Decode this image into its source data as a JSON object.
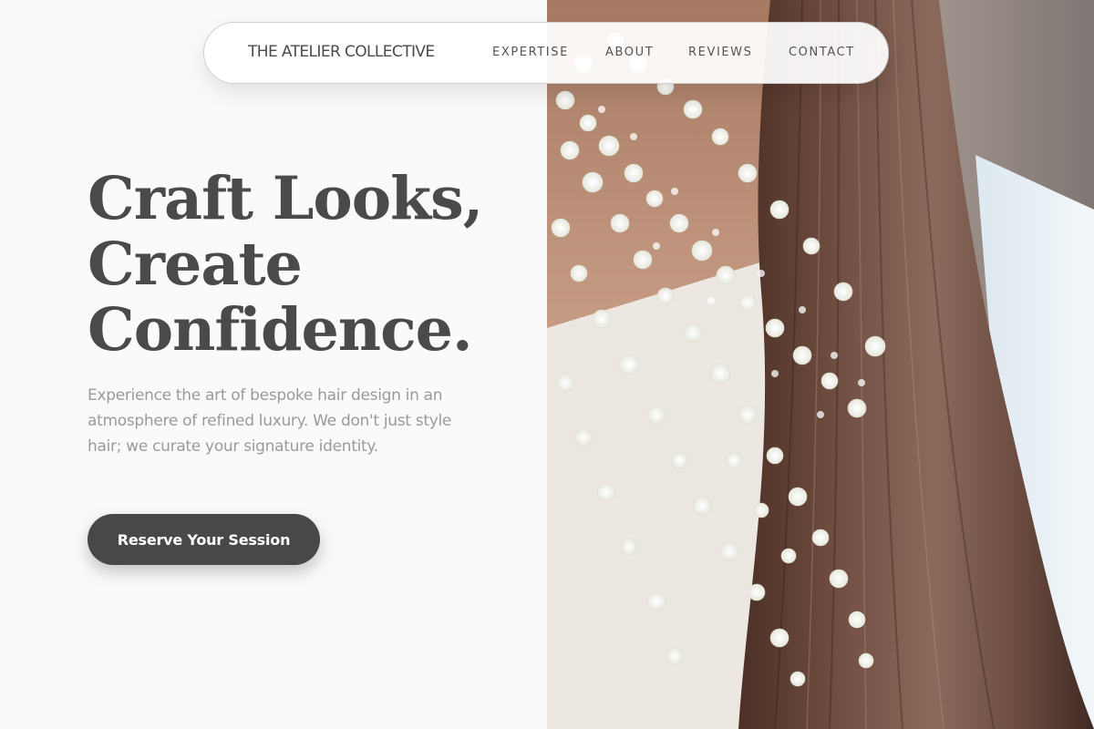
{
  "navbar": {
    "brand": "THE ATELIER COLLECTIVE",
    "links": [
      {
        "label": "EXPERTISE"
      },
      {
        "label": "ABOUT"
      },
      {
        "label": "REVIEWS"
      },
      {
        "label": "CONTACT"
      }
    ]
  },
  "hero": {
    "headline_lines": [
      "Craft Looks,",
      "Create",
      "Confidence."
    ],
    "subcopy": "Experience the art of bespoke hair design in an atmosphere of refined luxury. We don't just style hair; we curate your signature identity.",
    "cta_label": "Reserve Your Session"
  },
  "colors": {
    "background": "#fbfafa",
    "text_dark": "#4a4a4a",
    "text_muted": "#9a9a9a",
    "button": "#484848",
    "hair": "#6b4a3d"
  },
  "icons": {
    "hero_image": "woman-long-hair-with-babys-breath-flowers-photo"
  }
}
